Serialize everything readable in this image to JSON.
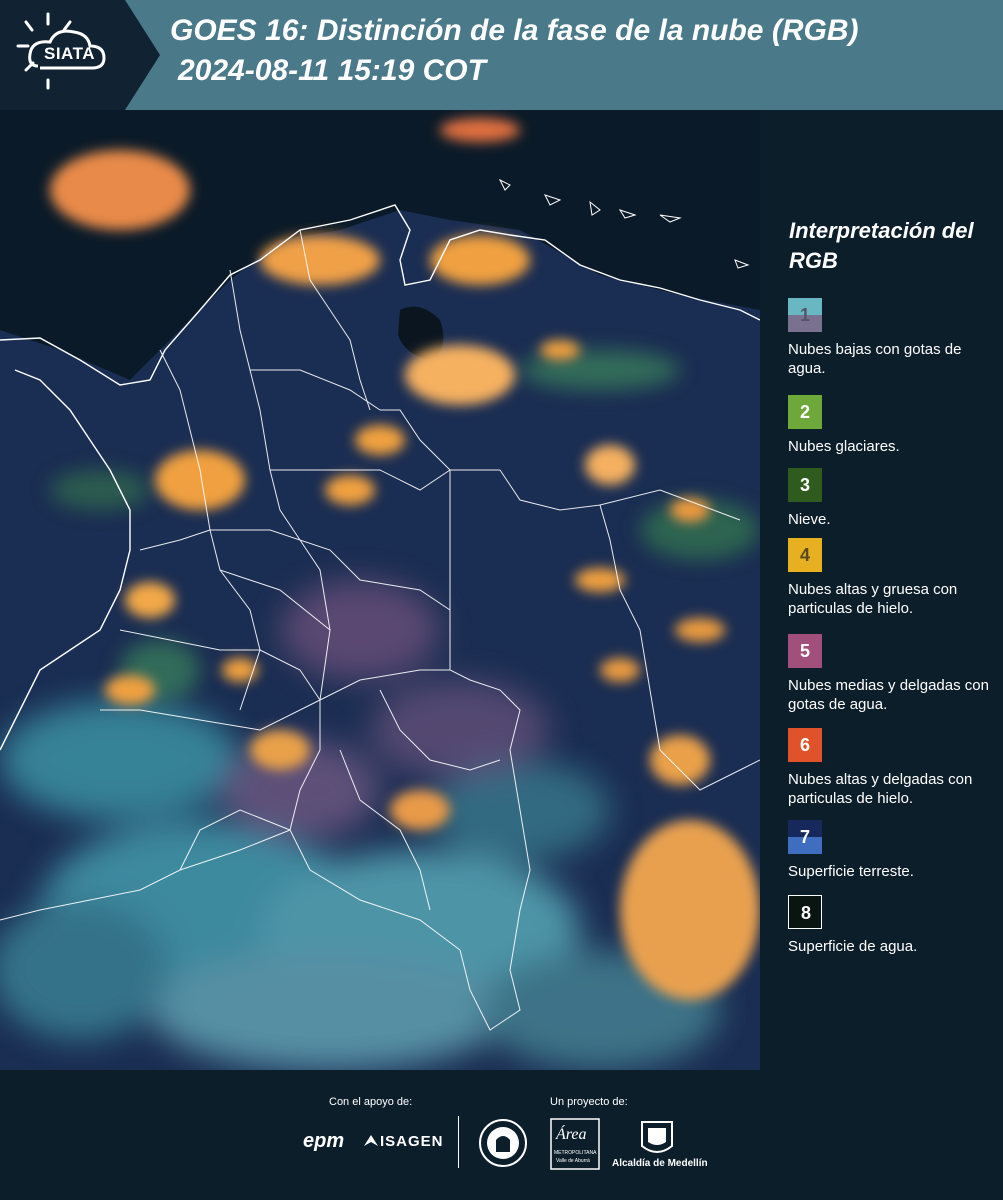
{
  "header": {
    "logo_text": "SIATA",
    "title_line1": "GOES 16: Distinción de la fase de la nube (RGB)",
    "title_line2": "2024-08-11 15:19 COT"
  },
  "legend": {
    "title": "Interpretación del RGB",
    "items": [
      {
        "number": "1",
        "description": "Nubes bajas con gotas de agua.",
        "color_top": "#6ab7c4",
        "color_bottom": "#7a7190",
        "num_color": "#555566"
      },
      {
        "number": "2",
        "description": "Nubes glaciares.",
        "color_top": "#6ea73a",
        "color_bottom": "#6ea73a",
        "num_color": "#ffffff"
      },
      {
        "number": "3",
        "description": "Nieve.",
        "color_top": "#2f5b1e",
        "color_bottom": "#2f5b1e",
        "num_color": "#ffffff"
      },
      {
        "number": "4",
        "description": "Nubes altas y gruesa con particulas de hielo.",
        "color_top": "#e6b020",
        "color_bottom": "#e6b020",
        "num_color": "#5a4a1a"
      },
      {
        "number": "5",
        "description": "Nubes medias y delgadas con gotas de agua.",
        "color_top": "#a0507a",
        "color_bottom": "#a0507a",
        "num_color": "#ffffff"
      },
      {
        "number": "6",
        "description": "Nubes altas y delgadas con particulas de hielo.",
        "color_top": "#e0522a",
        "color_bottom": "#e0522a",
        "num_color": "#ffffff"
      },
      {
        "number": "7",
        "description": "Superficie terreste.",
        "color_top": "#16285c",
        "color_bottom": "#3f6ec0",
        "num_color": "#ffffff"
      },
      {
        "number": "8",
        "description": "Superficie de agua.",
        "color_top": "#0a1410",
        "color_bottom": "#0a1410",
        "num_color": "#ffffff"
      }
    ]
  },
  "footer": {
    "support_label": "Con el apoyo de:",
    "project_label": "Un proyecto de:",
    "epm": "epm",
    "isagen": "ISAGEN",
    "area_text": "Área",
    "area_sub": "METROPOLITANA",
    "area_sub2": "Valle de Aburrá",
    "alcaldia": "Alcaldía de Medellín"
  },
  "colors": {
    "header_bg": "#4a7a8a",
    "page_bg": "#0d1e2b",
    "map_ocean": "#0b1a28",
    "land_dark": "#1a2d52",
    "cloud_orange": "#f0a040",
    "cloud_cyan": "#5fc0c8"
  }
}
